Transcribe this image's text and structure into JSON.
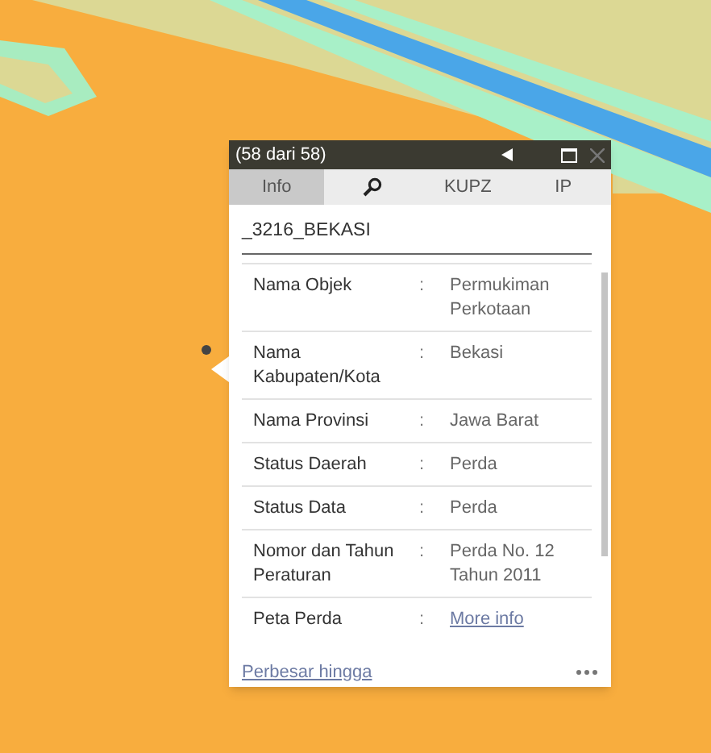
{
  "popup": {
    "title": "(58 dari 58)",
    "tabs": [
      {
        "kind": "text",
        "label": "Info",
        "selected": true
      },
      {
        "kind": "icon",
        "selected": false
      },
      {
        "kind": "text",
        "label": "KUPZ",
        "selected": false
      },
      {
        "kind": "text",
        "label": "IP",
        "selected": false
      }
    ],
    "feature_title": "_3216_BEKASI",
    "rows": [
      {
        "label": "Nama Objek",
        "separator": ":",
        "value": "Permukiman Perkotaan",
        "kind": "text"
      },
      {
        "label": "Nama Kabupaten/Kota",
        "separator": ":",
        "value": "Bekasi",
        "kind": "text"
      },
      {
        "label": "Nama Provinsi",
        "separator": ":",
        "value": "Jawa Barat",
        "kind": "text"
      },
      {
        "label": "Status Daerah",
        "separator": ":",
        "value": "Perda",
        "kind": "text"
      },
      {
        "label": "Status Data",
        "separator": ":",
        "value": "Perda",
        "kind": "text"
      },
      {
        "label": "Nomor dan Tahun Peraturan",
        "separator": ":",
        "value": "Perda No. 12 Tahun 2011",
        "kind": "text"
      },
      {
        "label": "Peta Perda",
        "separator": ":",
        "value": "More info",
        "kind": "link"
      }
    ],
    "zoom_link": "Perbesar hingga"
  }
}
